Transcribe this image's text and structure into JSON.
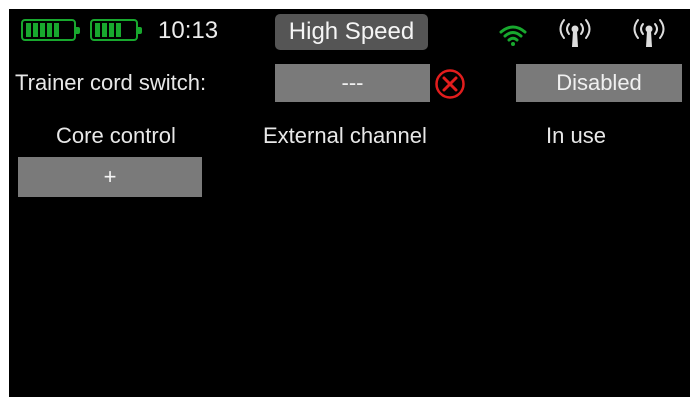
{
  "status_bar": {
    "time": "10:13",
    "mode": "High Speed",
    "battery_color": "#18a82e",
    "wifi_color": "#18a82e",
    "icons": [
      "battery-icon",
      "battery-icon",
      "wifi-icon",
      "antenna-icon",
      "antenna-icon"
    ]
  },
  "trainer": {
    "label": "Trainer cord switch:",
    "switch_value": "---",
    "clear_icon": "close-circle-icon",
    "clear_color": "#e11d1d",
    "state_label": "Disabled"
  },
  "columns": {
    "core": "Core control",
    "external": "External channel",
    "in_use": "In use"
  },
  "add_button": {
    "label": "+"
  }
}
